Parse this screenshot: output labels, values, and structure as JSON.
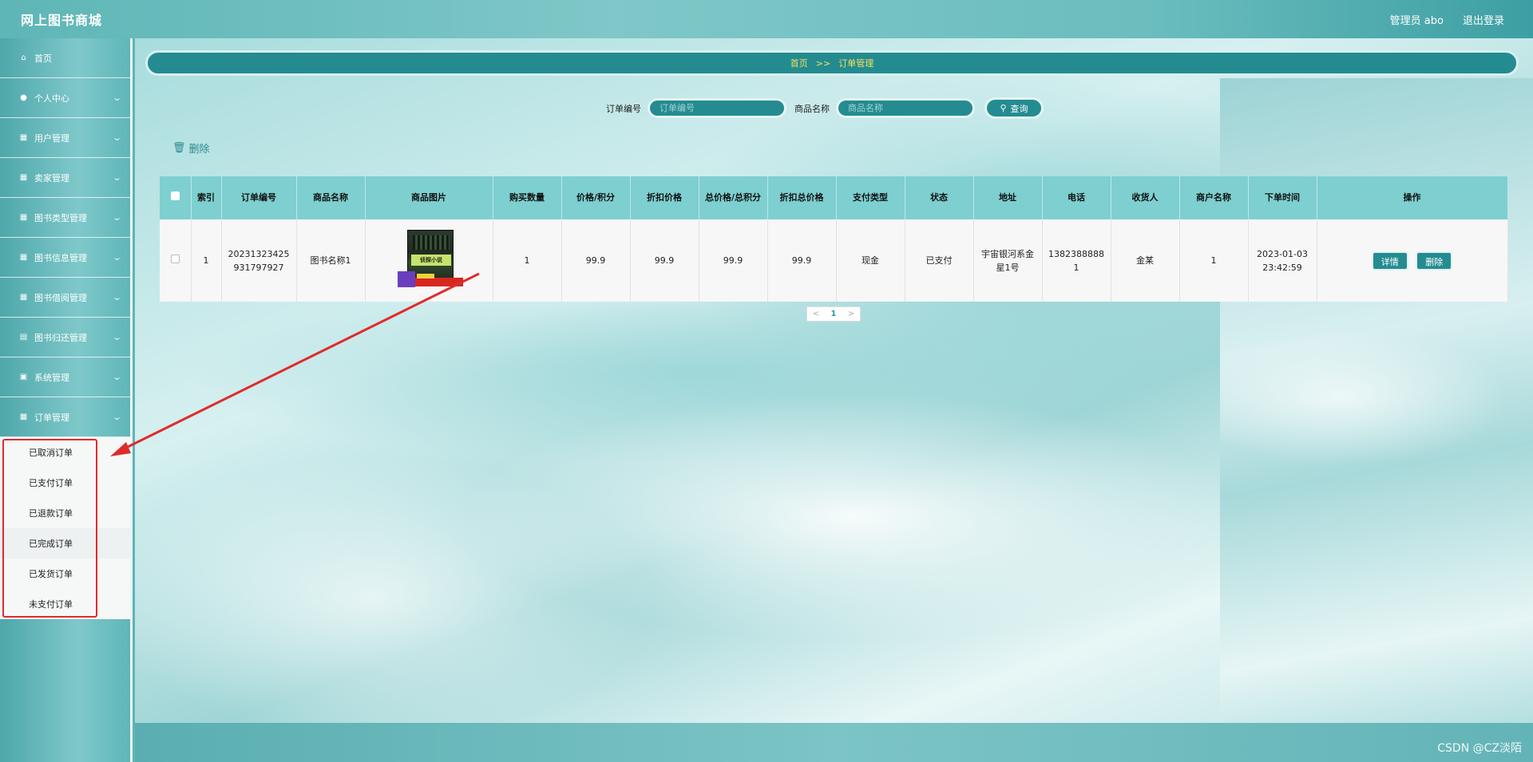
{
  "header": {
    "title": "网上图书商城",
    "admin_label": "管理员 abo",
    "logout_label": "退出登录"
  },
  "sidebar": {
    "items": [
      {
        "label": "首页",
        "icon": "home-icon"
      },
      {
        "label": "个人中心",
        "icon": "user-icon"
      },
      {
        "label": "用户管理",
        "icon": "grid-icon"
      },
      {
        "label": "卖家管理",
        "icon": "grid-icon"
      },
      {
        "label": "图书类型管理",
        "icon": "grid-icon"
      },
      {
        "label": "图书信息管理",
        "icon": "grid-icon"
      },
      {
        "label": "图书借阅管理",
        "icon": "grid-icon"
      },
      {
        "label": "图书归还管理",
        "icon": "clipboard-icon"
      },
      {
        "label": "系统管理",
        "icon": "clipboard-check-icon"
      },
      {
        "label": "订单管理",
        "icon": "grid-icon"
      }
    ],
    "order_submenu": [
      "已取消订单",
      "已支付订单",
      "已退款订单",
      "已完成订单",
      "已发货订单",
      "未支付订单"
    ]
  },
  "breadcrumb": {
    "home": "首页",
    "separator": ">>",
    "current": "订单管理"
  },
  "search": {
    "order_no_label": "订单编号",
    "order_no_placeholder": "订单编号",
    "product_name_label": "商品名称",
    "product_name_placeholder": "商品名称",
    "query_label": "查询"
  },
  "toolbar": {
    "delete_label": "删除"
  },
  "table": {
    "headers": [
      "",
      "索引",
      "订单编号",
      "商品名称",
      "商品图片",
      "购买数量",
      "价格/积分",
      "折扣价格",
      "总价格/总积分",
      "折扣总价格",
      "支付类型",
      "状态",
      "地址",
      "电话",
      "收货人",
      "商户名称",
      "下单时间",
      "操作"
    ],
    "rows": [
      {
        "index": "1",
        "order_no": "20231323425931797927",
        "product_name": "图书名称1",
        "image_title": "侦探小说",
        "quantity": "1",
        "price": "99.9",
        "discount_price": "99.9",
        "total_price": "99.9",
        "discount_total": "99.9",
        "pay_type": "现金",
        "status": "已支付",
        "address": "宇宙银河系金星1号",
        "phone": "13823888881",
        "receiver": "金某",
        "merchant": "1",
        "order_time": "2023-01-03 23:42:59",
        "detail_label": "详情",
        "delete_label": "删除"
      }
    ]
  },
  "pagination": {
    "prev": "<",
    "current": "1",
    "next": ">"
  },
  "watermark": "CSDN @CZ淡陌",
  "colors": {
    "primary": "#248c91",
    "header_bg": "#7ecfd0",
    "highlight": "#e02b2b"
  }
}
